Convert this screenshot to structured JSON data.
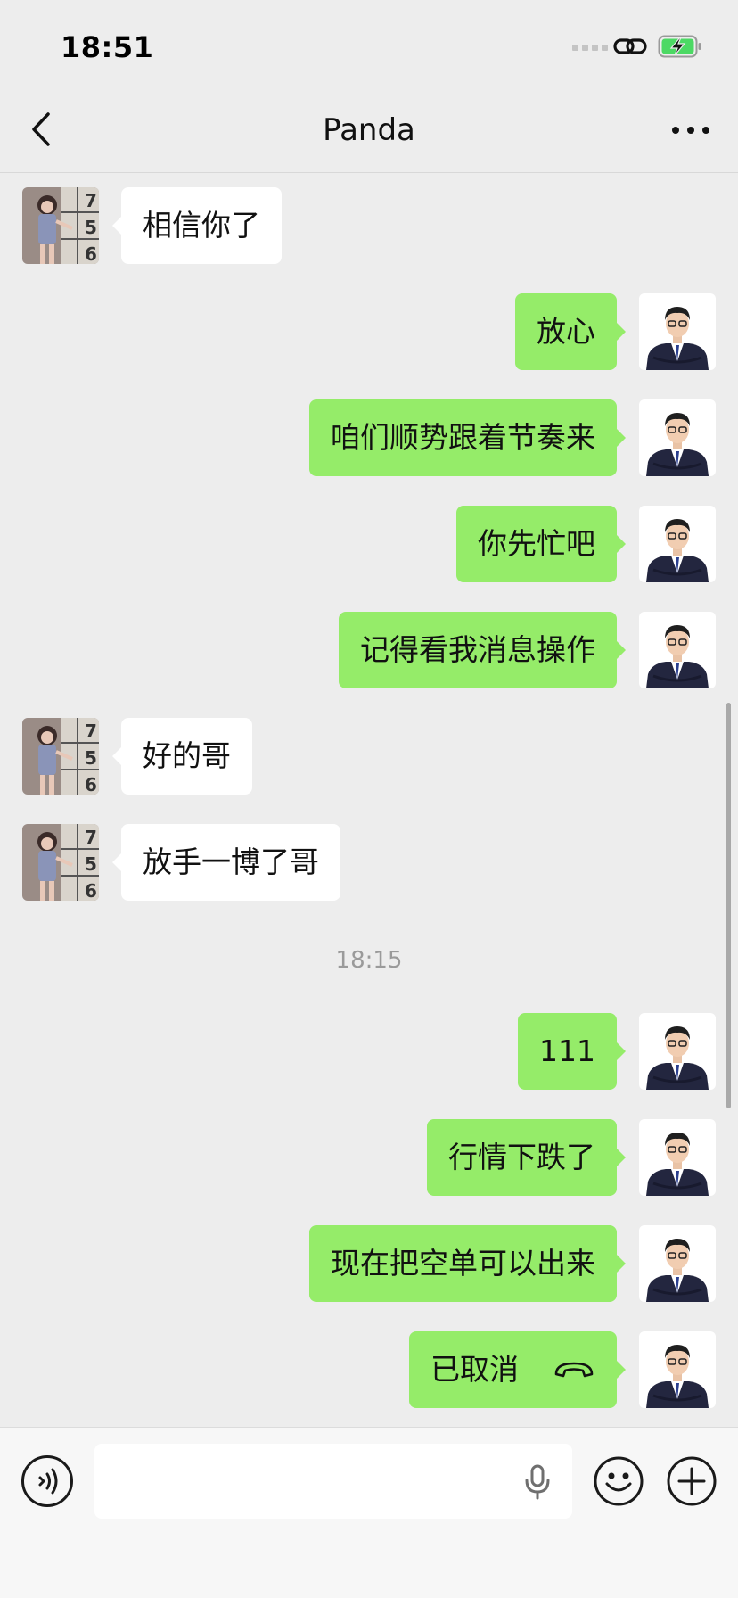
{
  "status_bar": {
    "time": "18:51"
  },
  "header": {
    "title": "Panda"
  },
  "messages": [
    {
      "side": "in",
      "text": "相信你了"
    },
    {
      "side": "out",
      "text": "放心"
    },
    {
      "side": "out",
      "text": "咱们顺势跟着节奏来"
    },
    {
      "side": "out",
      "text": "你先忙吧"
    },
    {
      "side": "out",
      "text": "记得看我消息操作"
    },
    {
      "side": "in",
      "text": "好的哥"
    },
    {
      "side": "in",
      "text": "放手一博了哥"
    },
    {
      "timestamp": "18:15"
    },
    {
      "side": "out",
      "text": "111"
    },
    {
      "side": "out",
      "text": "行情下跌了"
    },
    {
      "side": "out",
      "text": "现在把空单可以出来"
    },
    {
      "side": "out",
      "text": "已取消",
      "icon": "hang-up-icon"
    }
  ],
  "input": {
    "value": "",
    "placeholder": ""
  },
  "colors": {
    "outgoing_bubble": "#95ec69",
    "incoming_bubble": "#ffffff",
    "background": "#ededed",
    "battery_charging": "#4cd964"
  }
}
